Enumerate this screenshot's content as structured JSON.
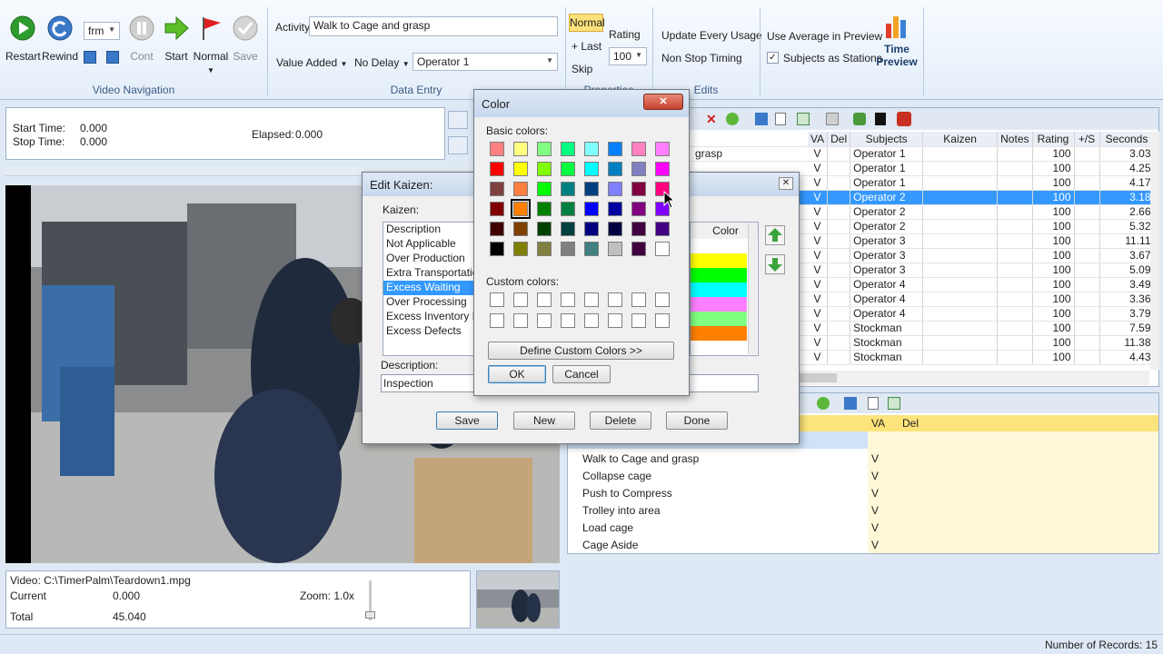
{
  "ribbon": {
    "video_nav": {
      "restart": "Restart",
      "rewind": "Rewind",
      "units": "frm",
      "cont": "Cont",
      "start": "Start",
      "normal": "Normal",
      "save": "Save",
      "title": "Video Navigation"
    },
    "data_entry": {
      "activity_label": "Activity",
      "activity_value": "Walk to Cage and grasp",
      "value_added": "Value Added",
      "no_delay": "No Delay",
      "operator": "Operator 1",
      "title": "Data Entry"
    },
    "properties": {
      "normal": "Normal",
      "last": "+ Last",
      "skip": "Skip",
      "rating_label": "Rating",
      "rating_value": "100",
      "title": "Properties"
    },
    "edits": {
      "update": "Update Every Usage",
      "non_stop": "Non Stop Timing",
      "title": "Edits"
    },
    "preview": {
      "use_average": "Use Average in Preview",
      "subjects_stations": "Subjects as Stations",
      "time_preview_1": "Time",
      "time_preview_2": "Preview"
    }
  },
  "timing": {
    "start_label": "Start Time:",
    "start_value": "0.000",
    "stop_label": "Stop Time:",
    "stop_value": "0.000",
    "elapsed_label": "Elapsed:",
    "elapsed_value": "0.000"
  },
  "video_info": {
    "path": "Video: C:\\TimerPalm\\Teardown1.mpg",
    "current_label": "Current",
    "current_value": "0.000",
    "total_label": "Total",
    "total_value": "45.040",
    "zoom": "Zoom: 1.0x"
  },
  "study_grid": {
    "headers": [
      "VA",
      "Del",
      "Subjects",
      "Kaizen",
      "Notes",
      "Rating",
      "+/S",
      "Seconds"
    ],
    "first_col_fragment": "grasp",
    "rows": [
      [
        "V",
        "",
        "Operator 1",
        "",
        "",
        "100",
        "",
        "3.03"
      ],
      [
        "V",
        "",
        "Operator 1",
        "",
        "",
        "100",
        "",
        "4.25"
      ],
      [
        "V",
        "",
        "Operator 1",
        "",
        "",
        "100",
        "",
        "4.17"
      ],
      [
        "V",
        "",
        "Operator 2",
        "",
        "",
        "100",
        "",
        "3.18"
      ],
      [
        "V",
        "",
        "Operator 2",
        "",
        "",
        "100",
        "",
        "2.66"
      ],
      [
        "V",
        "",
        "Operator 2",
        "",
        "",
        "100",
        "",
        "5.32"
      ],
      [
        "V",
        "",
        "Operator 3",
        "",
        "",
        "100",
        "",
        "11.11"
      ],
      [
        "V",
        "",
        "Operator 3",
        "",
        "",
        "100",
        "",
        "3.67"
      ],
      [
        "V",
        "",
        "Operator 3",
        "",
        "",
        "100",
        "",
        "5.09"
      ],
      [
        "V",
        "",
        "Operator 4",
        "",
        "",
        "100",
        "",
        "3.49"
      ],
      [
        "V",
        "",
        "Operator 4",
        "",
        "",
        "100",
        "",
        "3.36"
      ],
      [
        "V",
        "",
        "Operator 4",
        "",
        "",
        "100",
        "",
        "3.79"
      ],
      [
        "V",
        "",
        "Stockman",
        "",
        "",
        "100",
        "",
        "7.59"
      ],
      [
        "V",
        "",
        "Stockman",
        "",
        "",
        "100",
        "",
        "11.38"
      ],
      [
        "V",
        "",
        "Stockman",
        "",
        "",
        "100",
        "",
        "4.43"
      ]
    ]
  },
  "activity_list": {
    "headers": [
      "VA",
      "Del"
    ],
    "rows": [
      {
        "name": "Walk to Cage and grasp",
        "va": "V"
      },
      {
        "name": "Collapse cage",
        "va": "V"
      },
      {
        "name": "Push to Compress",
        "va": "V"
      },
      {
        "name": "Trolley into area",
        "va": "V"
      },
      {
        "name": "Load cage",
        "va": "V"
      },
      {
        "name": "Cage Aside",
        "va": "V"
      }
    ]
  },
  "edit_kaizen": {
    "title": "Edit Kaizen:",
    "kaizen_label": "Kaizen:",
    "items": [
      "Description",
      "Not Applicable",
      "Over Production",
      "Extra Transportation",
      "Excess Waiting",
      "Over Processing",
      "Excess Inventory P",
      "Excess Defects"
    ],
    "selected_index": 4,
    "color_header": "Color",
    "color_rows": [
      "#ffff00",
      "#00ff00",
      "#00ffff",
      "#ff80ff",
      "#80ff80",
      "#ff8000"
    ],
    "description_label": "Description:",
    "description_value": "Inspection",
    "buttons": {
      "save": "Save",
      "new": "New",
      "delete": "Delete",
      "done": "Done"
    }
  },
  "color_dialog": {
    "title": "Color",
    "basic_label": "Basic colors:",
    "custom_label": "Custom colors:",
    "define_button": "Define Custom Colors >>",
    "ok": "OK",
    "cancel": "Cancel",
    "selected_index": 25,
    "basic_colors": [
      "#ff8080",
      "#ffff80",
      "#80ff80",
      "#00ff80",
      "#80ffff",
      "#0080ff",
      "#ff80c0",
      "#ff80ff",
      "#ff0000",
      "#ffff00",
      "#80ff00",
      "#00ff40",
      "#00ffff",
      "#0080c0",
      "#8080c0",
      "#ff00ff",
      "#804040",
      "#ff8040",
      "#00ff00",
      "#008080",
      "#004080",
      "#8080ff",
      "#800040",
      "#ff0080",
      "#800000",
      "#ff8000",
      "#008000",
      "#008040",
      "#0000ff",
      "#0000a0",
      "#800080",
      "#8000ff",
      "#400000",
      "#804000",
      "#004000",
      "#004040",
      "#000080",
      "#000040",
      "#400040",
      "#400080",
      "#000000",
      "#808000",
      "#808040",
      "#808080",
      "#408080",
      "#c0c0c0",
      "#400040",
      "#ffffff"
    ]
  },
  "status": {
    "records": "Number of Records: 15"
  }
}
